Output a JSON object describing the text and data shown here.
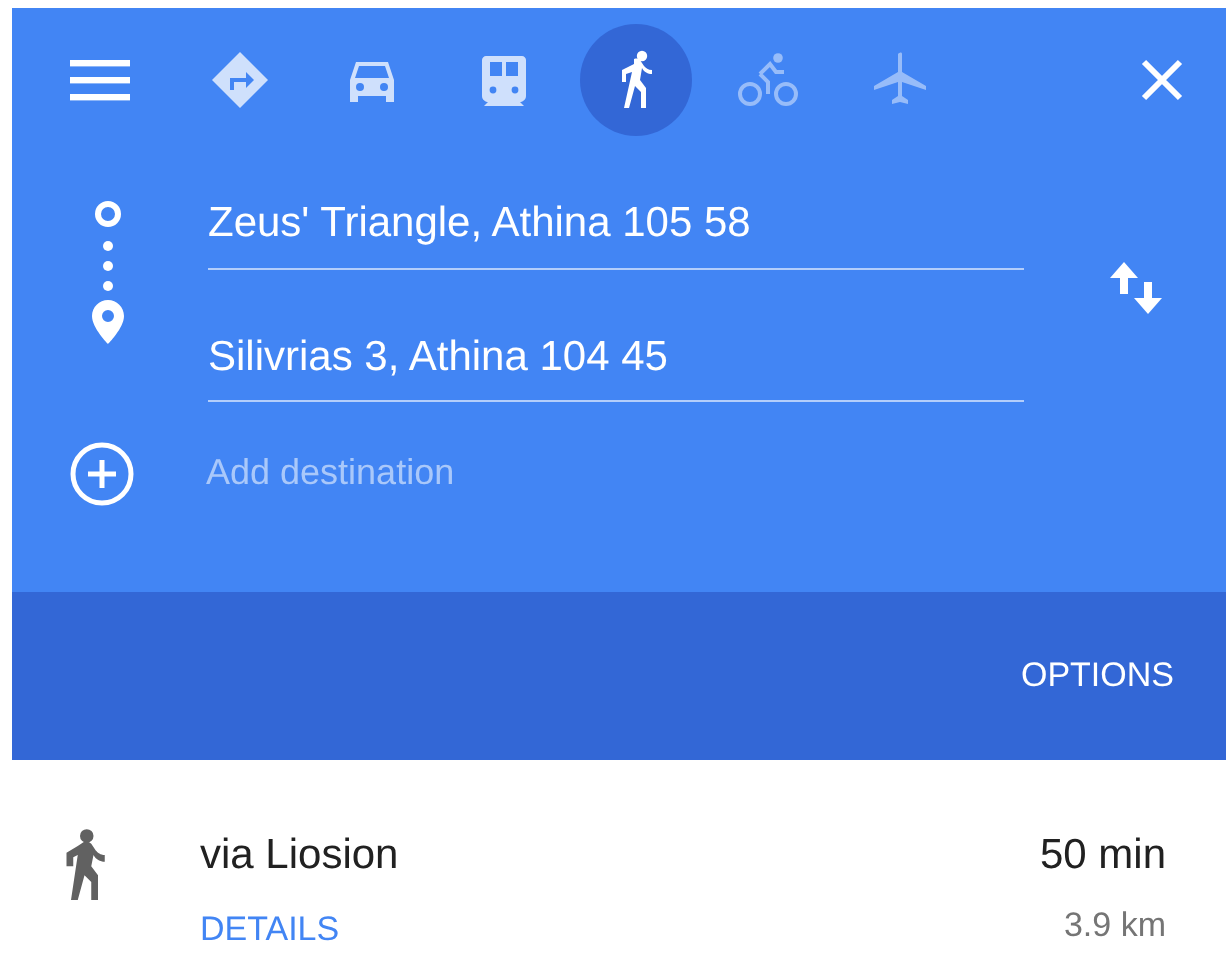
{
  "modes": [
    {
      "kind": "best",
      "selected": false,
      "disabled": false
    },
    {
      "kind": "car",
      "selected": false,
      "disabled": false
    },
    {
      "kind": "transit",
      "selected": false,
      "disabled": false
    },
    {
      "kind": "walk",
      "selected": true,
      "disabled": false
    },
    {
      "kind": "bike",
      "selected": false,
      "disabled": true
    },
    {
      "kind": "flight",
      "selected": false,
      "disabled": true
    }
  ],
  "waypoints": [
    {
      "kind": "origin",
      "value": "Zeus' Triangle, Athina 105 58"
    },
    {
      "kind": "destination",
      "value": "Silivrias 3, Athina 104 45"
    }
  ],
  "add_destination": {
    "placeholder": "Add destination"
  },
  "options_button": "OPTIONS",
  "route": {
    "title": "via Liosion",
    "duration": "50 min",
    "distance": "3.9 km",
    "details_link": "DETAILS"
  }
}
